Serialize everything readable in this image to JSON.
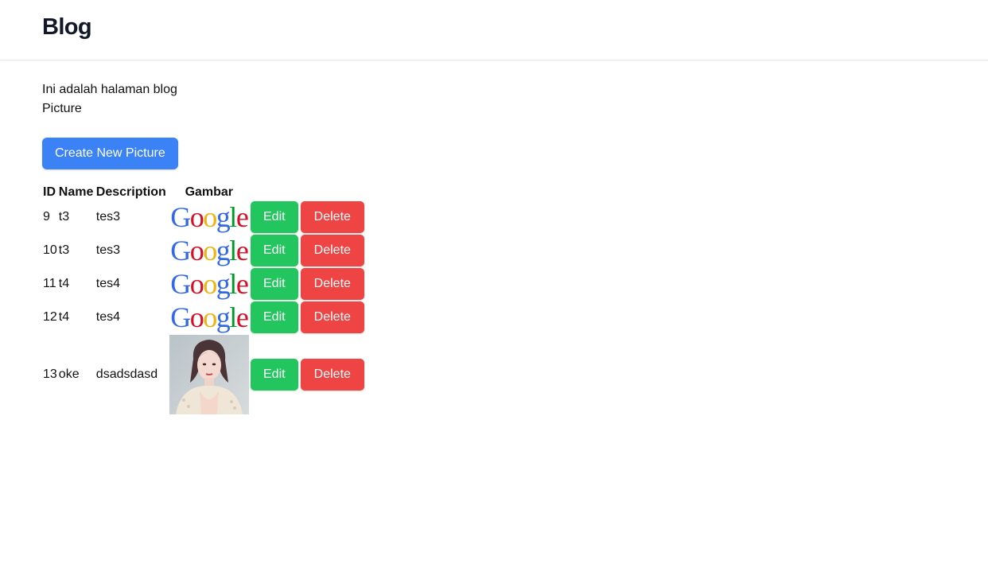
{
  "header": {
    "title": "Blog"
  },
  "main": {
    "intro": "Ini adalah halaman blog",
    "section_label": "Picture",
    "create_button": "Create New Picture"
  },
  "table": {
    "columns": [
      "ID",
      "Name",
      "Description",
      "Gambar"
    ],
    "rows": [
      {
        "id": "9",
        "name": "t3",
        "description": "tes3",
        "image": "google-logo",
        "edit": "Edit",
        "delete": "Delete"
      },
      {
        "id": "10",
        "name": "t3",
        "description": "tes3",
        "image": "google-logo",
        "edit": "Edit",
        "delete": "Delete"
      },
      {
        "id": "11",
        "name": "t4",
        "description": "tes4",
        "image": "google-logo",
        "edit": "Edit",
        "delete": "Delete"
      },
      {
        "id": "12",
        "name": "t4",
        "description": "tes4",
        "image": "google-logo",
        "edit": "Edit",
        "delete": "Delete"
      },
      {
        "id": "13",
        "name": "oke",
        "description": "dsadsdasd",
        "image": "portrait-photo",
        "edit": "Edit",
        "delete": "Delete"
      }
    ]
  },
  "google_logo": {
    "letters": [
      "G",
      "o",
      "o",
      "g",
      "l",
      "e"
    ],
    "colors": [
      "#3369e8",
      "#d50f25",
      "#eeb211",
      "#3369e8",
      "#009925",
      "#d50f25"
    ]
  },
  "colors": {
    "primary": "#3b82f6",
    "success": "#22c55e",
    "danger": "#ef4444"
  }
}
